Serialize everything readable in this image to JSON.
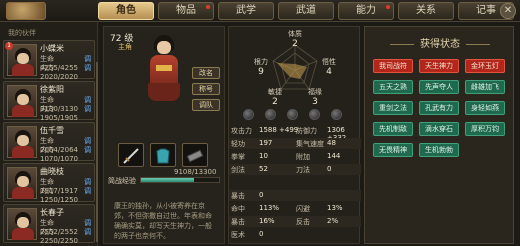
{
  "tabs": [
    {
      "label": "角色",
      "active": true,
      "dot": false
    },
    {
      "label": "物品",
      "active": false,
      "dot": true
    },
    {
      "label": "武学",
      "active": false,
      "dot": false
    },
    {
      "label": "武道",
      "active": false,
      "dot": false
    },
    {
      "label": "能力",
      "active": false,
      "dot": true
    },
    {
      "label": "关系",
      "active": false,
      "dot": false
    },
    {
      "label": "记事",
      "active": false,
      "dot": true
    }
  ],
  "close_glyph": "✕",
  "party": {
    "title": "我的伙伴",
    "members": [
      {
        "name": "小蝶米",
        "hp": "生命 4255/4255",
        "mp": "内力 2020/2020",
        "btn": "调",
        "badge": "1"
      },
      {
        "name": "徐紫阳",
        "hp": "生命 3130/3130",
        "mp": "内力 1905/1905",
        "btn": "调",
        "badge": ""
      },
      {
        "name": "伍千雪",
        "hp": "生命 2064/2064",
        "mp": "内力 1070/1070",
        "btn": "调",
        "badge": ""
      },
      {
        "name": "曲晓枝",
        "hp": "生命 1917/1917",
        "mp": "内力 1250/1250",
        "btn": "调",
        "badge": ""
      },
      {
        "name": "长春子",
        "hp": "生命 2552/2552",
        "mp": "内力 2250/2250",
        "btn": "调",
        "badge": ""
      }
    ]
  },
  "hero": {
    "level": "72 级",
    "subtitle": "主角",
    "buttons": [
      "改名",
      "称号",
      "调队"
    ],
    "xp_label": "简战经验",
    "xp_text": "9108/13300",
    "xp_fraction": 0.685,
    "desc": "康王的独孙，从小被寄养在京郊，不但弥撒自过世。年表和命确确实莫，却写天生神力，一般的两子也奈何不。"
  },
  "radar": {
    "top": {
      "name": "体质",
      "value": "2"
    },
    "left": {
      "name": "根力",
      "value": "9"
    },
    "right": {
      "name": "悟性",
      "value": "4"
    },
    "bl": {
      "name": "敏捷",
      "value": "2"
    },
    "br": {
      "name": "福缘",
      "value": "3"
    }
  },
  "stats": [
    {
      "l1": "攻击力",
      "v1": "1588 +499",
      "l2": "防御力",
      "v2": "1306 +332"
    },
    {
      "l1": "轻功",
      "v1": "197",
      "l2": "集气速度",
      "v2": "48"
    },
    {
      "l1": "拳掌",
      "v1": "10",
      "l2": "附加",
      "v2": "144"
    },
    {
      "l1": "剑法",
      "v1": "52",
      "l2": "刀法",
      "v2": "0"
    },
    {
      "l1": "",
      "v1": "",
      "l2": "",
      "v2": ""
    },
    {
      "l1": "暴击",
      "v1": "0",
      "l2": "",
      "v2": ""
    },
    {
      "l1": "命中",
      "v1": "113%",
      "l2": "闪避",
      "v2": "13%"
    },
    {
      "l1": "暴击",
      "v1": "16%",
      "l2": "反击",
      "v2": "2%"
    },
    {
      "l1": "医术",
      "v1": "0",
      "l2": "",
      "v2": ""
    }
  ],
  "status": {
    "title": "获得状态",
    "items": [
      {
        "label": "我司战符",
        "style": "red"
      },
      {
        "label": "天生神力",
        "style": "red"
      },
      {
        "label": "金环玉灯",
        "style": "red"
      },
      {
        "label": "五天之熟",
        "style": "green"
      },
      {
        "label": "先声夺人",
        "style": "green"
      },
      {
        "label": "雌雄加飞",
        "style": "green"
      },
      {
        "label": "重剑之法",
        "style": "green"
      },
      {
        "label": "孔武有力",
        "style": "green"
      },
      {
        "label": "身轻如燕",
        "style": "green"
      },
      {
        "label": "先机制敌",
        "style": "green"
      },
      {
        "label": "滴水穿石",
        "style": "green"
      },
      {
        "label": "厚积万钧",
        "style": "green"
      },
      {
        "label": "无畏精神",
        "style": "green"
      },
      {
        "label": "生机勃勃",
        "style": "green"
      }
    ]
  }
}
